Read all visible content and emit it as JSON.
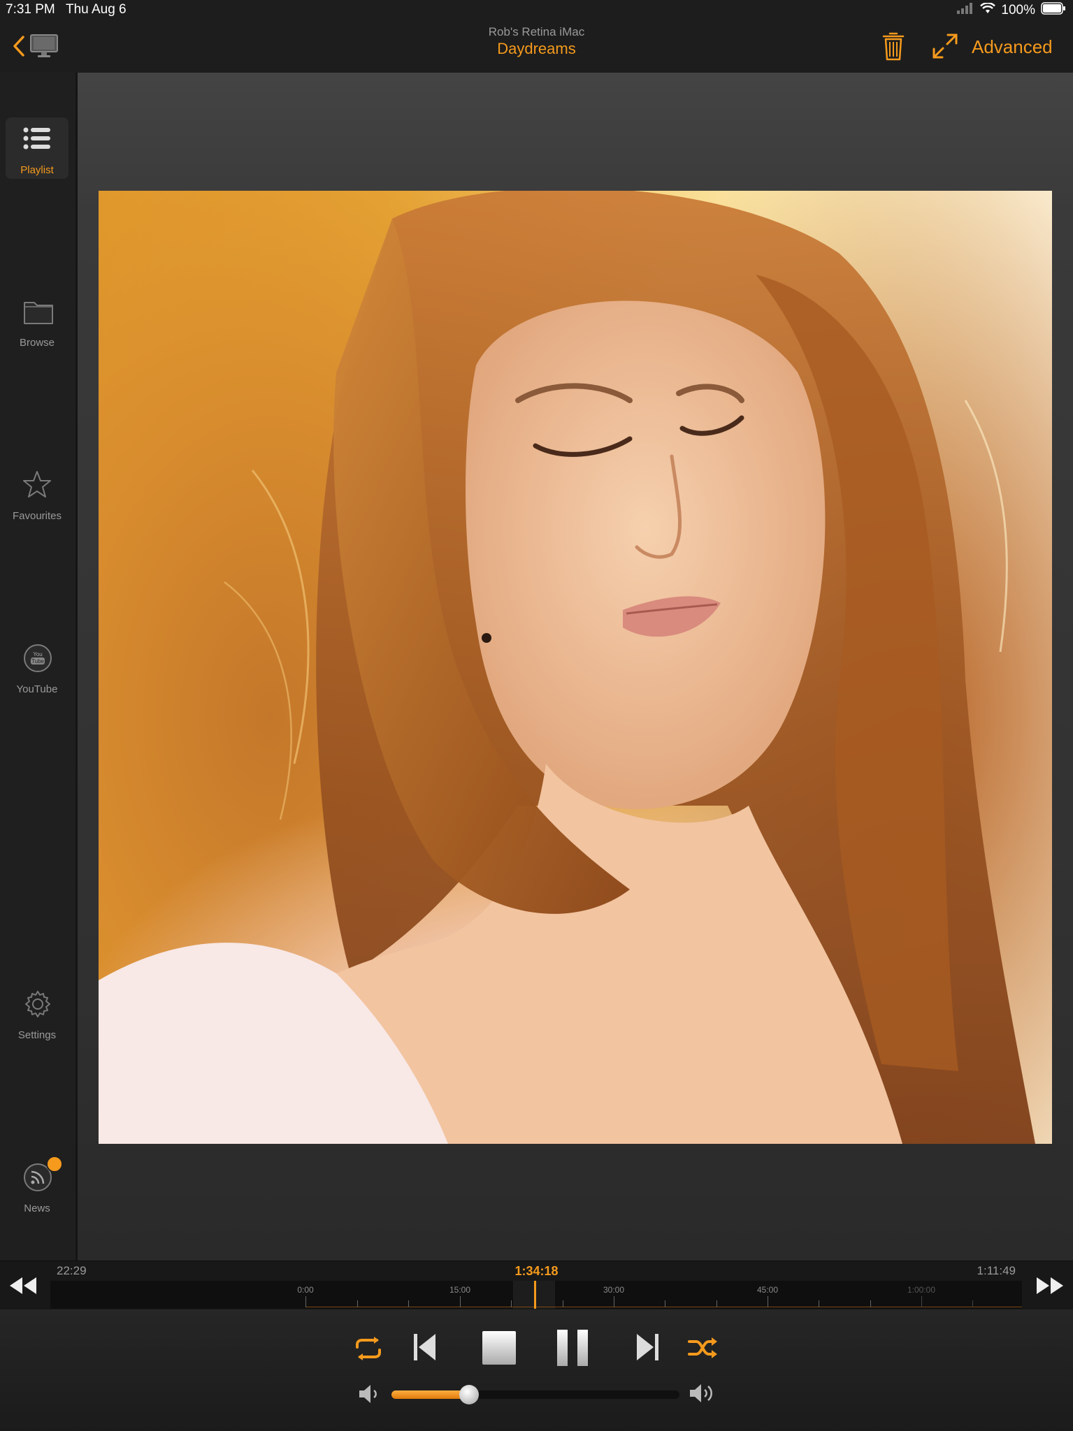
{
  "status_bar": {
    "time": "7:31 PM",
    "date": "Thu Aug 6",
    "battery": "100%"
  },
  "header": {
    "device_name": "Rob's Retina iMac",
    "title": "Daydreams",
    "advanced_label": "Advanced",
    "icons": [
      "chevron-left-icon",
      "monitor-icon",
      "trash-icon",
      "expand-icon"
    ]
  },
  "sidebar": {
    "items": [
      {
        "label": "Playlist",
        "icon": "list-icon",
        "active": true
      },
      {
        "label": "Browse",
        "icon": "folder-icon",
        "active": false
      },
      {
        "label": "Favourites",
        "icon": "star-icon",
        "active": false
      },
      {
        "label": "YouTube",
        "icon": "youtube-icon",
        "active": false
      },
      {
        "label": "Settings",
        "icon": "gear-icon",
        "active": false
      },
      {
        "label": "News",
        "icon": "rss-icon",
        "active": false,
        "has_badge": true
      }
    ]
  },
  "timeline": {
    "elapsed": "22:29",
    "current": "1:34:18",
    "total": "1:11:49",
    "tick_labels": [
      "0:00",
      "15:00",
      "30:00",
      "45:00",
      "1:00:00"
    ]
  },
  "transport": {
    "buttons": [
      "repeat",
      "previous",
      "stop",
      "pause",
      "next",
      "shuffle"
    ],
    "volume_fraction": 0.27
  },
  "colors": {
    "accent": "#f59a1d",
    "background": "#1c1c1c",
    "panel": "#1f1f1f"
  }
}
